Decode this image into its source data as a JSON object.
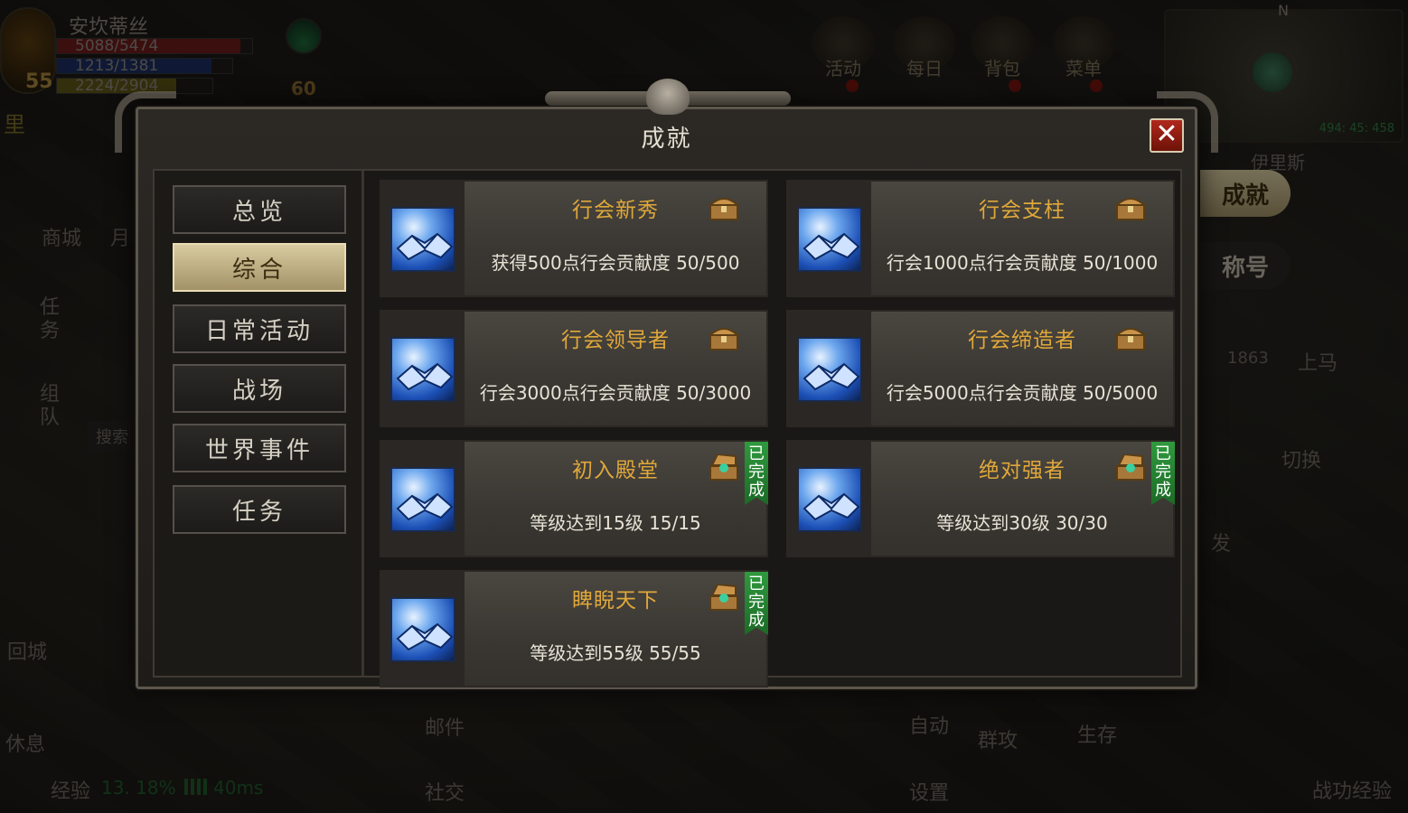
{
  "hud": {
    "player_name": "安坎蒂丝",
    "hp": "5088/5474",
    "mp": "1213/1381",
    "xp_bar": "2224/2904",
    "level": "55",
    "secondary_level": "60",
    "left_labels": [
      "里",
      "商城",
      "月",
      "任务",
      "组队",
      "搜索",
      "回城",
      "休息"
    ],
    "top_menu": [
      "活动",
      "每日",
      "背包",
      "菜单"
    ],
    "minimap_coords": "494: 45: 458",
    "map_name": "伊里斯",
    "compass": "N",
    "side_tabs": [
      "成就",
      "称号"
    ],
    "right_labels": [
      "1863",
      "上马",
      "切换",
      "发"
    ],
    "bottom_labels": [
      "邮件",
      "社交",
      "自动",
      "设置",
      "群攻",
      "生存",
      "战功经验"
    ],
    "status_line": {
      "exp_label": "经验",
      "exp_value": "13. 18%",
      "ping": "40ms"
    }
  },
  "dialog": {
    "title": "成就",
    "close_symbol": "✕",
    "nav": [
      {
        "label": "总览",
        "active": false
      },
      {
        "label": "综合",
        "active": true
      },
      {
        "label": "日常活动",
        "active": false
      },
      {
        "label": "战场",
        "active": false
      },
      {
        "label": "世界事件",
        "active": false
      },
      {
        "label": "任务",
        "active": false
      }
    ],
    "achievements": [
      {
        "name": "行会新秀",
        "desc": "获得500点行会贡献度  50/500",
        "done": false
      },
      {
        "name": "行会支柱",
        "desc": "行会1000点行会贡献度  50/1000",
        "done": false
      },
      {
        "name": "行会领导者",
        "desc": "行会3000点行会贡献度  50/3000",
        "done": false
      },
      {
        "name": "行会缔造者",
        "desc": "行会5000点行会贡献度  50/5000",
        "done": false
      },
      {
        "name": "初入殿堂",
        "desc": "等级达到15级  15/15",
        "done": true
      },
      {
        "name": "绝对强者",
        "desc": "等级达到30级  30/30",
        "done": true
      },
      {
        "name": "睥睨天下",
        "desc": "等级达到55级  55/55",
        "done": true
      }
    ],
    "done_badge": [
      "已",
      "完",
      "成"
    ]
  },
  "colors": {
    "accent_gold": "#e0a83a",
    "done_green": "#2f9a3e",
    "close_red": "#b0281c"
  }
}
